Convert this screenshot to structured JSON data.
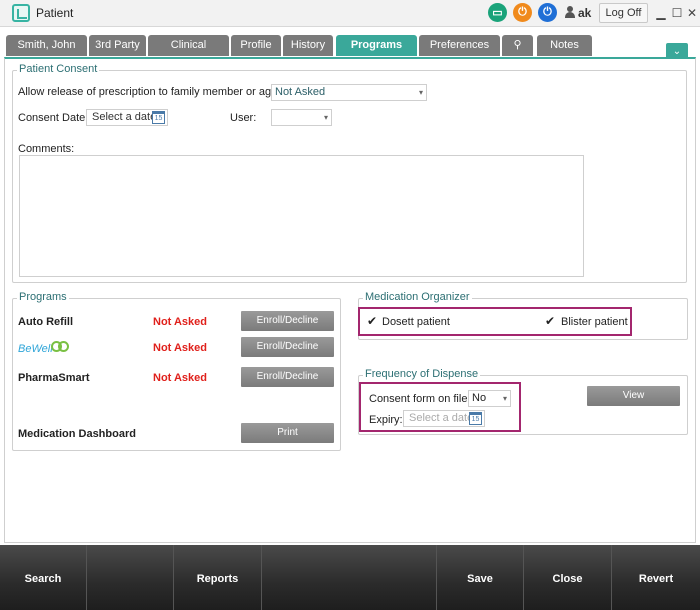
{
  "window": {
    "title": "Patient",
    "user": "ak",
    "logoff": "Log Off",
    "minimize": "▁",
    "maximize": "☐",
    "close": "✕",
    "status_colors": {
      "green": "#1aa37a",
      "orange": "#f08a1c",
      "blue": "#1f6fd6"
    }
  },
  "tabs": [
    {
      "label": "Smith, John"
    },
    {
      "label": "3rd Party"
    },
    {
      "label": "Clinical"
    },
    {
      "label": "Profile"
    },
    {
      "label": "History"
    },
    {
      "label": "Programs",
      "active": true
    },
    {
      "label": "Preferences"
    },
    {
      "label": "",
      "icon": "paperclip-icon"
    },
    {
      "label": "Notes"
    }
  ],
  "collapse_icon": "chevron-double-down-icon",
  "patient_consent": {
    "legend": "Patient Consent",
    "release_label": "Allow release of prescription to family member or agent:",
    "release_value": "Not Asked",
    "consent_date_label": "Consent Date:",
    "consent_date_value": "Select a date",
    "user_label": "User:",
    "user_value": "",
    "comments_label": "Comments:"
  },
  "programs": {
    "legend": "Programs",
    "items": [
      {
        "name": "Auto Refill",
        "status": "Not Asked",
        "action": "Enroll/Decline"
      },
      {
        "name": "BeWell",
        "status": "Not Asked",
        "action": "Enroll/Decline"
      },
      {
        "name": "PharmaSmart",
        "status": "Not Asked",
        "action": "Enroll/Decline"
      }
    ],
    "dashboard_label": "Medication Dashboard",
    "print_label": "Print"
  },
  "medication_organizer": {
    "legend": "Medication Organizer",
    "dosett_label": "Dosett patient",
    "dosett_checked": true,
    "blister_label": "Blister patient",
    "blister_checked": true,
    "check_glyph": "✔"
  },
  "frequency_of_dispense": {
    "legend": "Frequency of Dispense",
    "consent_label": "Consent form on file:",
    "consent_value": "No",
    "expiry_label": "Expiry:",
    "expiry_placeholder": "Select a date",
    "view_label": "View"
  },
  "bottom_bar": {
    "search": "Search",
    "reports": "Reports",
    "save": "Save",
    "close": "Close",
    "revert": "Revert"
  },
  "highlight_color": "#a3266e"
}
